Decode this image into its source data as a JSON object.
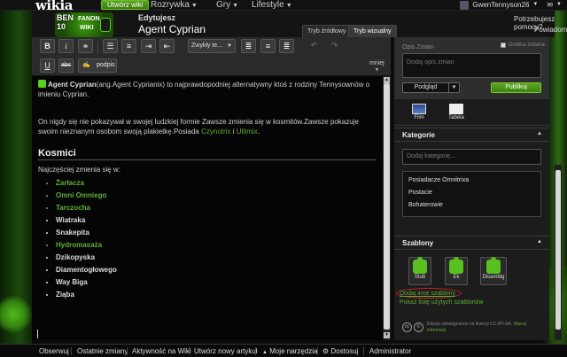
{
  "global_nav": {
    "logo": "wikia",
    "create_wiki": "Utwórz wiki",
    "menus": [
      {
        "label": "Rozrywka"
      },
      {
        "label": "Gry"
      },
      {
        "label": "Lifestyle"
      }
    ],
    "username": "GwenTennyson26"
  },
  "header": {
    "wiki_logo": {
      "ben": "BEN",
      "ten": "10",
      "fandom": "FANON",
      "wiki": "WIKI"
    },
    "editing_label": "Edytujesz",
    "page_title": "Agent Cyprian",
    "tabs": [
      {
        "label": "Tryb źródłowy"
      },
      {
        "label": "Tryb wizualny"
      }
    ],
    "help": "Potrzebujesz pomocy?",
    "notifications": "Powiadomienia"
  },
  "toolbar": {
    "bold": "B",
    "italic": "i",
    "link_icon": "link-icon",
    "format_select": "Zwykły te...",
    "underline": "U",
    "strike": "abc",
    "signature": "podpis",
    "more": "mniej"
  },
  "content": {
    "intro_name": "Agent Cyprian",
    "intro_rest": "(ang.Agent Cyprianix) to najprawdopodniej alternatywny ktoś z rodziny Tennysownów o imieniu Cyprian.",
    "para2_a": "On nigdy się nie pokazywał w swojej ludzkiej formie Zawsze zmienia się w kosmitów.Zawsze pokazuje swoim nieznanym osobom swoją plakietkę.Posiada",
    "para2_link1": "Czynotrix",
    "para2_and": "i",
    "para2_link2": "Ultimix",
    "section_heading": "Kosmici",
    "section_intro": "Najczęściej zmienia się w:",
    "aliens": [
      {
        "name": "Żarłacza",
        "linked": true
      },
      {
        "name": "Omni Omniego",
        "linked": true
      },
      {
        "name": "Tarczocha",
        "linked": true
      },
      {
        "name": "Wiatraka",
        "linked": false
      },
      {
        "name": "Snakepita",
        "linked": false
      },
      {
        "name": "Hydromasaża",
        "linked": true
      },
      {
        "name": "Dzikopyska",
        "linked": false
      },
      {
        "name": "Diamentogłowego",
        "linked": false
      },
      {
        "name": "Way Biga",
        "linked": false
      },
      {
        "name": "Ziąba",
        "linked": false
      }
    ]
  },
  "rail": {
    "summary_label": "Opis Zmian",
    "minor_edit": "Drobna zmiana",
    "summary_placeholder": "Dodaj opis zmian",
    "preview": "Podgląd",
    "publish": "Publikuj",
    "media": [
      {
        "label": "Film",
        "icon": "film-icon"
      },
      {
        "label": "Tabela",
        "icon": "table-icon"
      }
    ],
    "categories_title": "Kategorie",
    "category_placeholder": "Dodaj kategorię...",
    "categories": [
      "Posiadacze Omnitrixa",
      "Postacie",
      "Bohaterowie"
    ],
    "templates_title": "Szablony",
    "templates": [
      {
        "label": "Stub"
      },
      {
        "label": "Ek"
      },
      {
        "label": "Disambig"
      }
    ],
    "add_template": "Dodaj inne szablony",
    "recent_templates": "Pokaż listę użytych szablonów",
    "license_text": "Edycje udostępnione na licencji CC-BY-SA.",
    "license_link": "Więcej informacji"
  },
  "bottom_toolbar": {
    "items": [
      {
        "label": "Obserwuj"
      },
      {
        "label": "Ostatnie zmiany"
      },
      {
        "label": "Aktywność na Wiki"
      },
      {
        "label": "Utwórz nowy artykuł"
      },
      {
        "label": "Moje narzędzia"
      },
      {
        "label": "Dostosuj"
      },
      {
        "label": "Administrator"
      }
    ]
  },
  "colors": {
    "accent_green": "#5fae33",
    "publish_green": "#4a9418",
    "background": "#0b0b0b"
  }
}
